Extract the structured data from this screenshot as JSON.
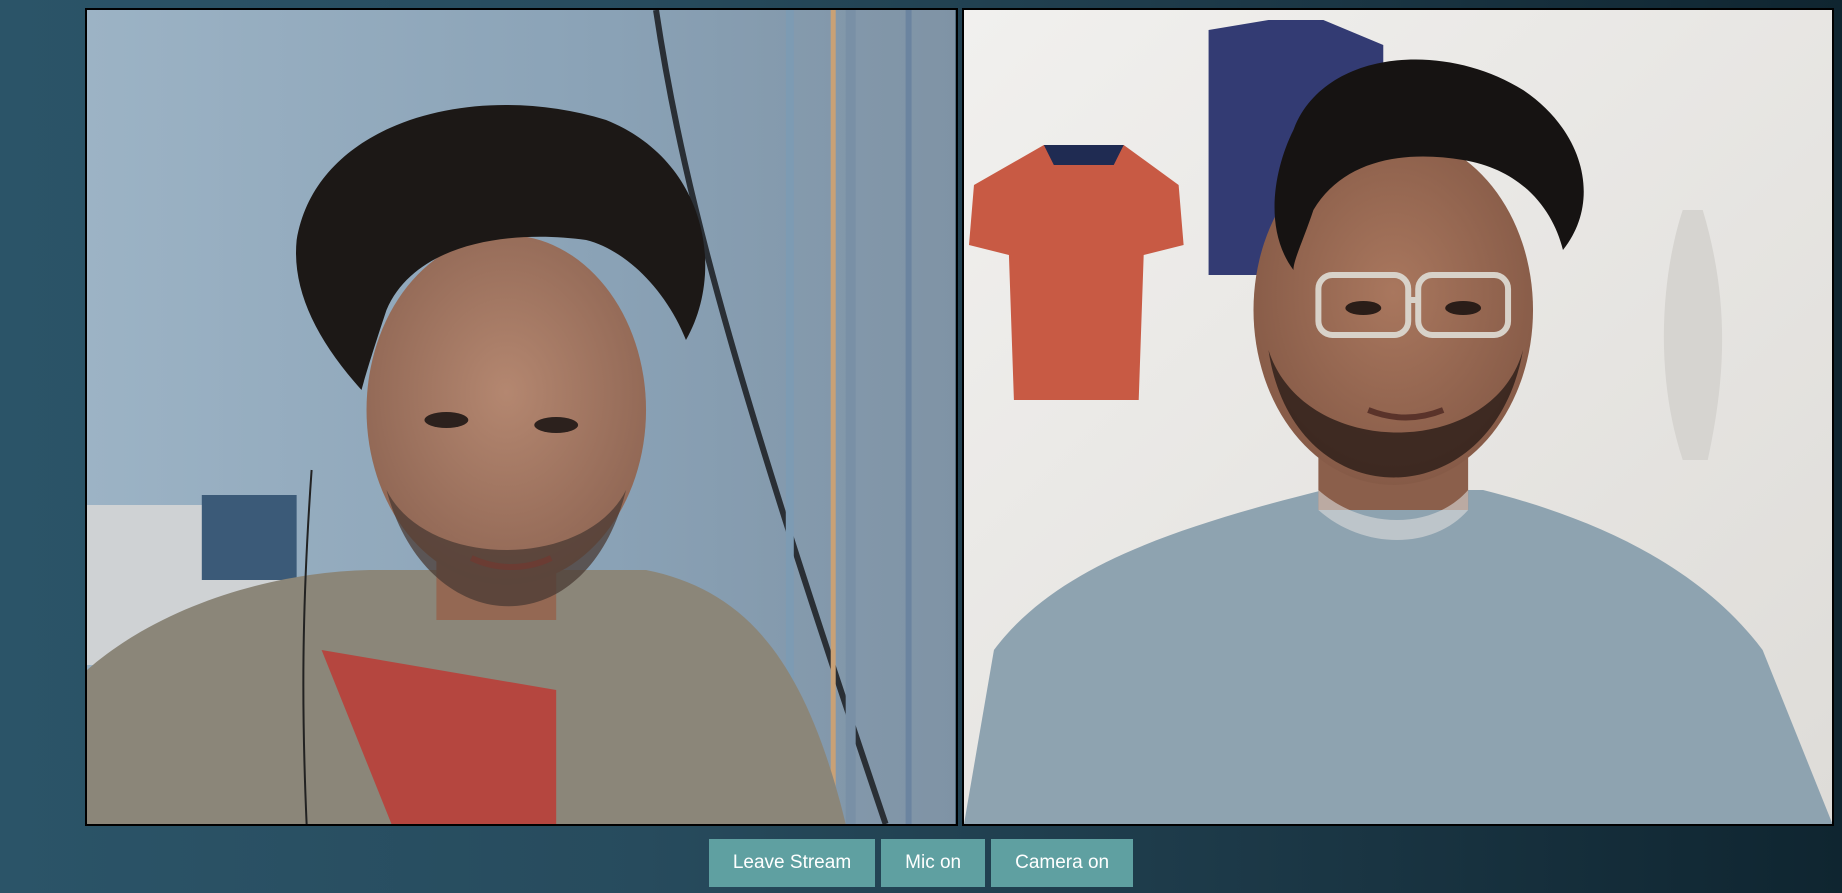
{
  "participants": [
    {
      "id": "remote",
      "feed_description_icon": "person-video-icon",
      "background": "#8ea1b3"
    },
    {
      "id": "local",
      "feed_description_icon": "person-video-icon",
      "background": "#e9e8e6"
    }
  ],
  "controls": {
    "leave_label": "Leave Stream",
    "mic_label": "Mic on",
    "camera_label": "Camera on"
  },
  "colors": {
    "button_bg": "#5fa0a1",
    "button_text": "#ffffff",
    "tile_border": "#000000"
  }
}
